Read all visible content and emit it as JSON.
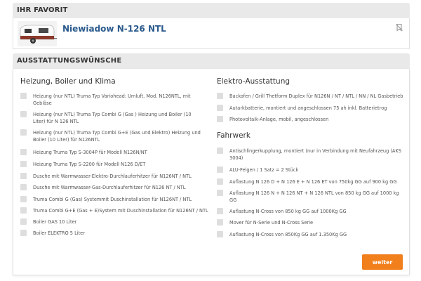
{
  "favorit": {
    "header": "IHR FAVORIT",
    "title": "Niewiadow N-126 NTL"
  },
  "wuensche": {
    "header": "AUSSTATTUNGSWÜNSCHE",
    "groups": {
      "heizung": {
        "title": "Heizung, Boiler und Klima",
        "items": [
          "Heizung (nur NTL) Truma Typ Variohead: Umluft, Mod. N126NTL, mit Gebläse",
          "Heizung (nur NTL) Truma Typ Combi G (Gas ) Heizung und Boiler (10 Liter) für N 126 NTL",
          "Heizung (nur NTL) Truma Typ Combi G+E (Gas und Elektro) Heizung und Boiler (10 Liter) für N126NTL",
          "Heizung Truma Typ S-3004P für Modell N126N/NT",
          "Heizung Truma Typ S-2200 für Modell N126 D/ET",
          "Dusche mit Warmwasser-Elektro-Durchlauferhitzer für N126NT / NTL",
          "Dusche mit Warmwasser-Gas-Durchlauferhitzer für N126 NT / NTL",
          "Truma Combi G (Gas) Systemmit Duschinstallation für N126NT / NTL",
          "Truma Combi G+E (Gas + E)System mit Duschinstallation für N126NT / NTL",
          "Boiler GAS 10 Liter",
          "Boiler ELEKTRO 5 Liter"
        ]
      },
      "elektro": {
        "title": "Elektro-Ausstattung",
        "items": [
          "Backofen / Grill Thetform Duplex für N126N / NT / NTL / NN / NL Gasbetrieb",
          "Autarkbatterie, montiert und angeschlossen 75 ah inkl. Batterietrog",
          "Photovoltaik-Anlage, mobil, angeschlossen"
        ]
      },
      "fahrwerk": {
        "title": "Fahrwerk",
        "items": [
          "Antischlingerkupplung, montiert (nur in Verbindung mit Neufahrzeug (AKS 3004)",
          "ALU-Felgen / 1 Satz = 2 Stück",
          "Auflastung N 126 D + N 126 E + N 126 ET von 750kg GG auf 900 kg GG",
          "Auflastung N 126 N + N 126 NT + N 126 NTL von 850 kg GG auf 1000 kg GG",
          "Auflastung N-Cross von 850 kg GG auf 1000Kg GG",
          "Mover für N-Serie und N-Cross Serie",
          "Auflastung N-Cross von 850Kg GG auf 1.350Kg GG"
        ]
      }
    },
    "button_label": "weiter"
  },
  "colors": {
    "accent": "#f07f1c",
    "title_blue": "#2a5a8c",
    "header_bg": "#e9e9e9",
    "checkbox": "#dedede"
  },
  "icons": {
    "remove": "bookmark-remove-icon",
    "thumb": "caravan-thumbnail"
  }
}
